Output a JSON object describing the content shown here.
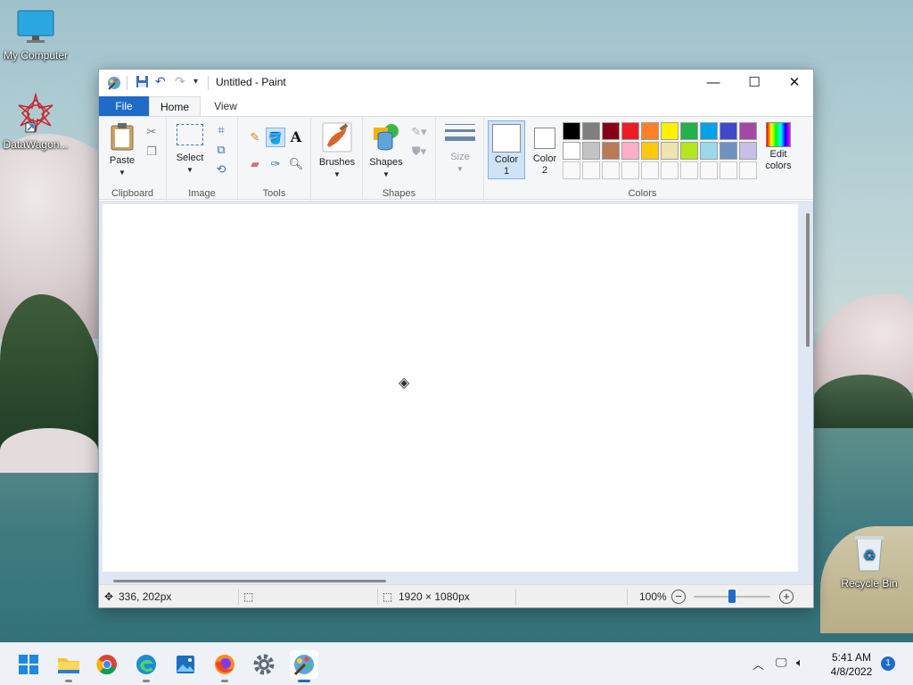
{
  "desktop": {
    "icons": [
      {
        "label": "My Computer"
      },
      {
        "label": "DataWagon..."
      },
      {
        "label": "Recycle Bin"
      }
    ]
  },
  "window": {
    "title": "Untitled - Paint",
    "tabs": {
      "file": "File",
      "home": "Home",
      "view": "View"
    },
    "help": "?"
  },
  "ribbon": {
    "clipboard": {
      "paste": "Paste",
      "group": "Clipboard"
    },
    "image": {
      "select": "Select",
      "group": "Image"
    },
    "tools": {
      "group": "Tools"
    },
    "brushes": {
      "label": "Brushes"
    },
    "shapes": {
      "label": "Shapes",
      "group": "Shapes"
    },
    "size": {
      "label": "Size"
    },
    "colors": {
      "color1_line1": "Color",
      "color1_line2": "1",
      "color2_line1": "Color",
      "color2_line2": "2",
      "edit_line1": "Edit",
      "edit_line2": "colors",
      "group": "Colors",
      "palette_row1": [
        "#000000",
        "#7f7f7f",
        "#880015",
        "#ed1c24",
        "#ff7f27",
        "#fff200",
        "#22b14c",
        "#00a2e8",
        "#3f48cc",
        "#a349a4"
      ],
      "palette_row2": [
        "#ffffff",
        "#c3c3c3",
        "#b97a57",
        "#ffaec9",
        "#ffc90e",
        "#efe4b0",
        "#b5e61d",
        "#99d9ea",
        "#7092be",
        "#c8bfe7"
      ]
    }
  },
  "status": {
    "cursor_pos": "336, 202px",
    "canvas_size": "1920 × 1080px",
    "zoom": "100%",
    "zoom_minus": "−",
    "zoom_plus": "+"
  },
  "taskbar": {
    "time": "5:41 AM",
    "date": "4/8/2022",
    "notifications": "1"
  }
}
